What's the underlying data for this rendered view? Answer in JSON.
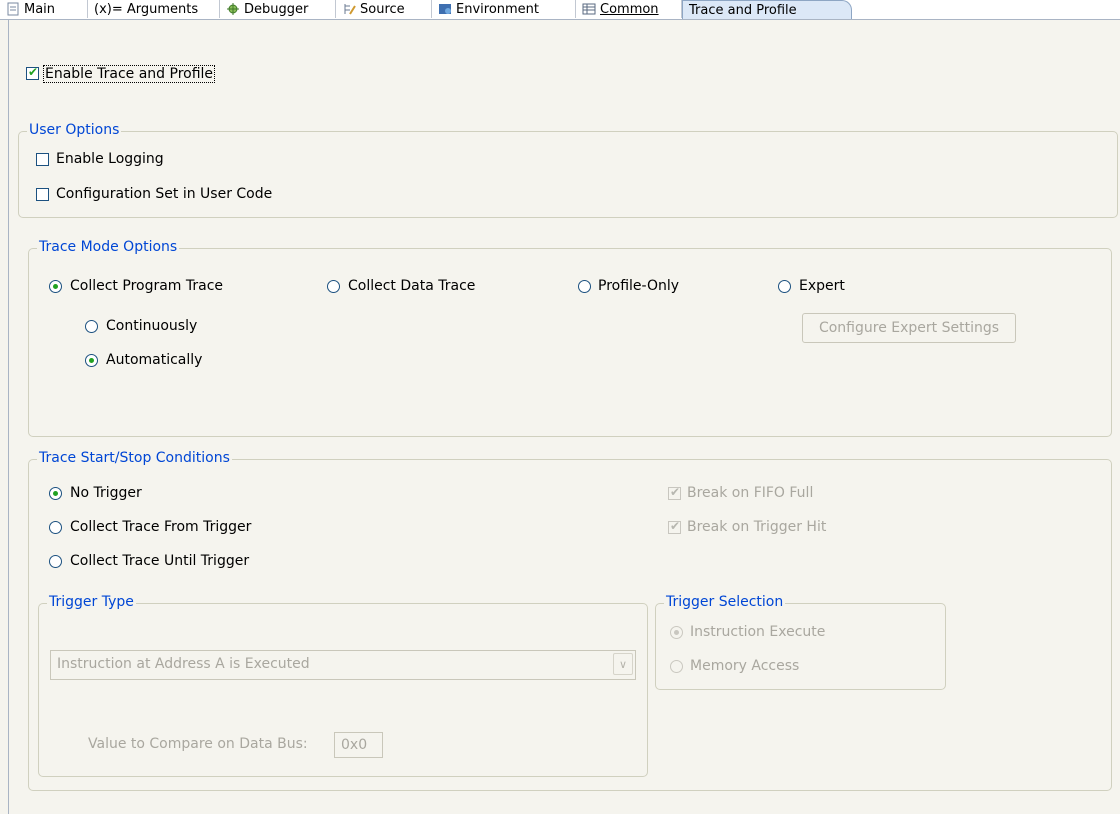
{
  "tabs": [
    {
      "label": "Main",
      "icon": "main-tab-icon"
    },
    {
      "label": "(x)= Arguments",
      "icon": "arguments-icon"
    },
    {
      "label": "Debugger",
      "icon": "debugger-bug-icon"
    },
    {
      "label": "Source",
      "icon": "source-icon"
    },
    {
      "label": "Environment",
      "icon": "environment-icon"
    },
    {
      "label": "Common",
      "icon": "common-icon"
    },
    {
      "label": "Trace and Profile",
      "icon": ""
    }
  ],
  "enable_trace": {
    "label": "Enable Trace and Profile",
    "checked": true
  },
  "user_options": {
    "title": "User Options",
    "enable_logging": {
      "label": "Enable Logging",
      "checked": false
    },
    "config_set": {
      "label": "Configuration Set in User Code",
      "checked": false
    }
  },
  "trace_mode": {
    "title": "Trace Mode Options",
    "program_trace": "Collect Program Trace",
    "data_trace": "Collect Data Trace",
    "profile_only": "Profile-Only",
    "expert": "Expert",
    "continuously": "Continuously",
    "automatically": "Automatically",
    "configure_expert": "Configure Expert Settings"
  },
  "start_stop": {
    "title": "Trace Start/Stop Conditions",
    "no_trigger": "No Trigger",
    "from_trigger": "Collect Trace From Trigger",
    "until_trigger": "Collect Trace Until Trigger",
    "break_fifo": "Break on FIFO Full",
    "break_trigger": "Break on Trigger Hit",
    "trigger_type": {
      "title": "Trigger Type",
      "selected": "Instruction at Address A is Executed",
      "compare_label": "Value to Compare on Data Bus:",
      "compare_value": "0x0"
    },
    "trigger_selection": {
      "title": "Trigger Selection",
      "instruction_execute": "Instruction Execute",
      "memory_access": "Memory Access"
    }
  },
  "colors": {
    "accent_green": "#21a121",
    "group_title_blue": "#0046d5",
    "disabled_text": "#a9a79f"
  }
}
